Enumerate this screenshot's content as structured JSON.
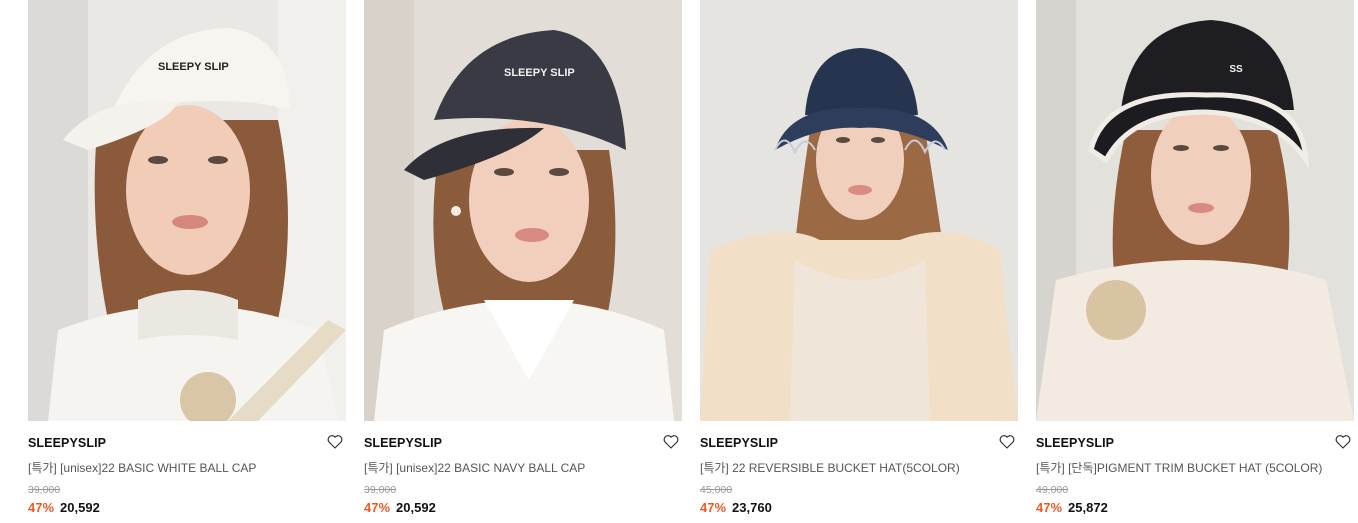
{
  "products": [
    {
      "brand": "SLEEPYSLIP",
      "title": "[특가] [unisex]22 BASIC WHITE BALL CAP",
      "original_price": "39,000",
      "discount": "47%",
      "price": "20,592",
      "photo_text": "SLEEPY SLIP"
    },
    {
      "brand": "SLEEPYSLIP",
      "title": "[특가] [unisex]22 BASIC NAVY BALL CAP",
      "original_price": "39,000",
      "discount": "47%",
      "price": "20,592",
      "photo_text": "SLEEPY SLIP"
    },
    {
      "brand": "SLEEPYSLIP",
      "title": "[특가] 22 REVERSIBLE BUCKET HAT(5COLOR)",
      "original_price": "45,000",
      "discount": "47%",
      "price": "23,760",
      "photo_text": ""
    },
    {
      "brand": "SLEEPYSLIP",
      "title": "[특가] [단독]PIGMENT TRIM BUCKET HAT (5COLOR)",
      "original_price": "49,000",
      "discount": "47%",
      "price": "25,872",
      "photo_text": "SS"
    }
  ],
  "colors": {
    "discount": "#ee5a24",
    "strike_price": "#999999",
    "title": "#555555"
  },
  "icons": {
    "wishlist": "heart-outline-icon"
  }
}
